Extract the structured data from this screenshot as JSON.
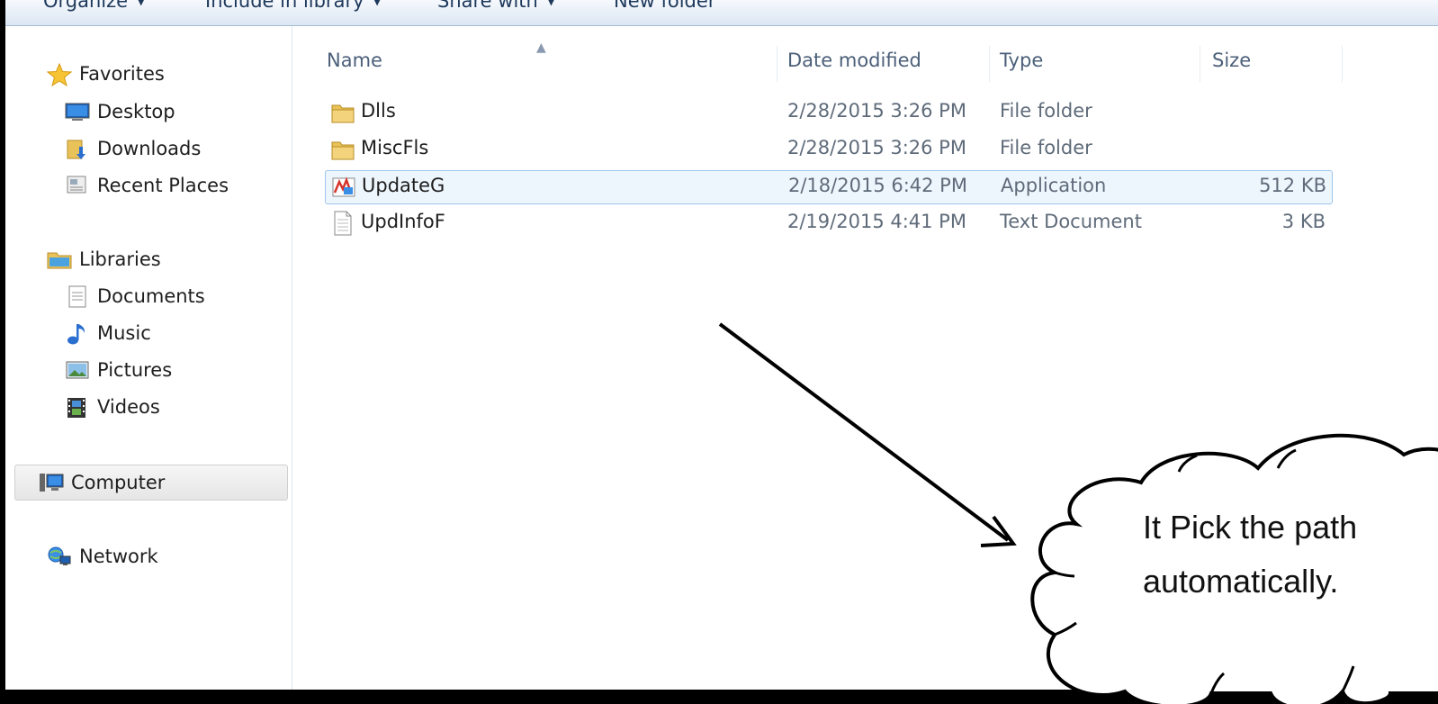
{
  "toolbar": {
    "organize": "Organize",
    "include_in_library": "Include in library",
    "share_with": "Share with",
    "new_folder": "New folder"
  },
  "nav": {
    "favorites": "Favorites",
    "desktop": "Desktop",
    "downloads": "Downloads",
    "recent_places": "Recent Places",
    "libraries": "Libraries",
    "documents": "Documents",
    "music": "Music",
    "pictures": "Pictures",
    "videos": "Videos",
    "computer": "Computer",
    "network": "Network"
  },
  "columns": {
    "name": "Name",
    "date_modified": "Date modified",
    "type": "Type",
    "size": "Size"
  },
  "files": [
    {
      "name": "Dlls",
      "date": "2/28/2015 3:26 PM",
      "type": "File folder",
      "size": "",
      "icon": "folder-icon"
    },
    {
      "name": "MiscFls",
      "date": "2/28/2015 3:26 PM",
      "type": "File folder",
      "size": "",
      "icon": "folder-icon"
    },
    {
      "name": "UpdateG",
      "date": "2/18/2015 6:42 PM",
      "type": "Application",
      "size": "512 KB",
      "icon": "application-icon"
    },
    {
      "name": "UpdInfoF",
      "date": "2/19/2015 4:41 PM",
      "type": "Text Document",
      "size": "3 KB",
      "icon": "text-document-icon"
    }
  ],
  "annotation": {
    "line1": "It Pick the path",
    "line2": "automatically."
  },
  "colors": {
    "selection": "#eef6fd",
    "selection_border": "#9fc6ec",
    "toolbar_text": "#1e395b"
  }
}
